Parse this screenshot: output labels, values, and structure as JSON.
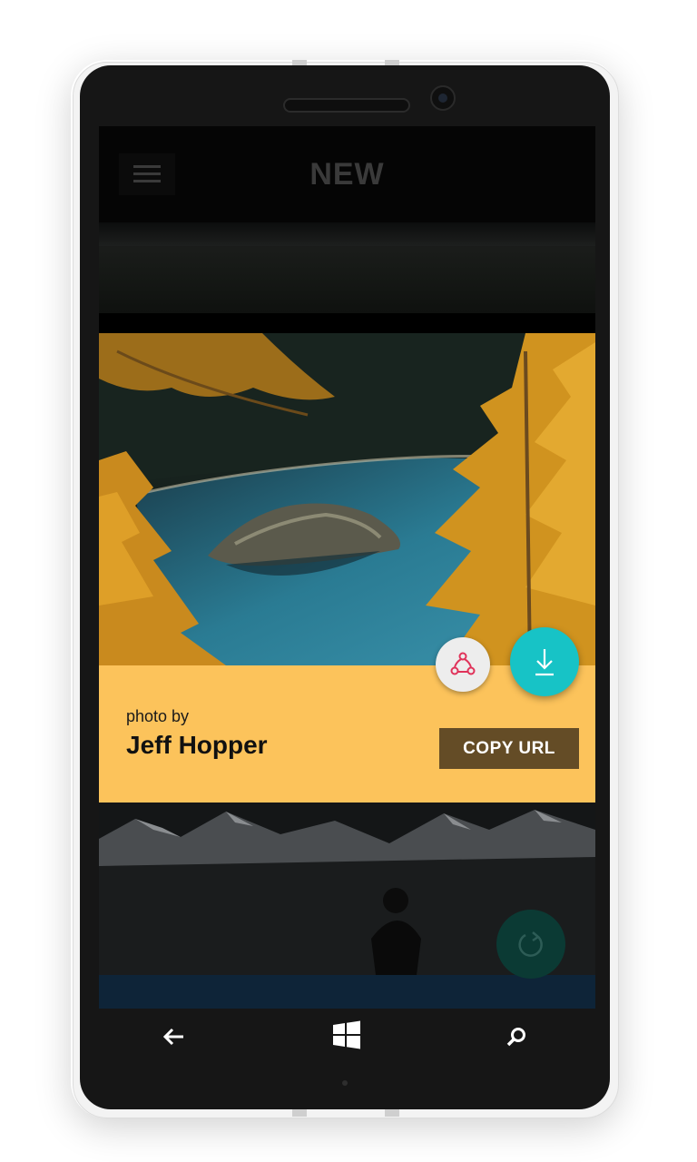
{
  "appbar": {
    "title": "NEW",
    "menu_icon": "hamburger-icon"
  },
  "photo_card": {
    "photo_by_label": "photo by",
    "author": "Jeff Hopper",
    "copy_url_label": "COPY URL",
    "share_icon": "share-icon",
    "download_icon": "download-icon"
  },
  "refresh_icon": "refresh-icon",
  "navbar": {
    "back_icon": "back-arrow-icon",
    "windows_icon": "windows-logo-icon",
    "search_icon": "search-icon"
  },
  "colors": {
    "panel": "#fcc35b",
    "copy_button": "#644c26",
    "download_fab": "#17c3c6",
    "share_fab": "#ededed",
    "share_icon": "#e0335a"
  }
}
